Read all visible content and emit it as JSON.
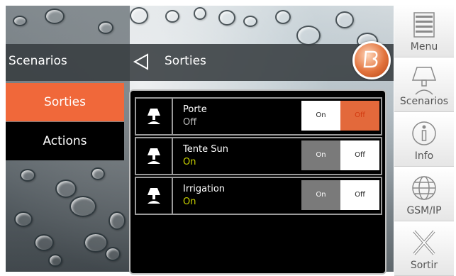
{
  "header": {
    "left_title": "Scenarios",
    "current_title": "Sorties"
  },
  "left_menu": {
    "items": [
      {
        "label": "Sorties",
        "active": true
      },
      {
        "label": "Actions",
        "active": false
      }
    ]
  },
  "outputs": [
    {
      "name": "Porte",
      "status": "Off",
      "on_label": "On",
      "off_label": "Off",
      "selected": "off"
    },
    {
      "name": "Tente Sun",
      "status": "On",
      "on_label": "On",
      "off_label": "Off",
      "selected": "on"
    },
    {
      "name": "Irrigation",
      "status": "On",
      "on_label": "On",
      "off_label": "Off",
      "selected": "on"
    }
  ],
  "sidebar": {
    "items": [
      {
        "label": "Menu",
        "icon": "list-icon"
      },
      {
        "label": "Scenarios",
        "icon": "lamp-icon"
      },
      {
        "label": "Info",
        "icon": "info-icon"
      },
      {
        "label": "GSM/IP",
        "icon": "globe-icon"
      },
      {
        "label": "Sortir",
        "icon": "close-icon"
      }
    ]
  },
  "colors": {
    "accent": "#f0683a",
    "status_on": "#c9d200",
    "status_off": "#bdbdbd"
  }
}
